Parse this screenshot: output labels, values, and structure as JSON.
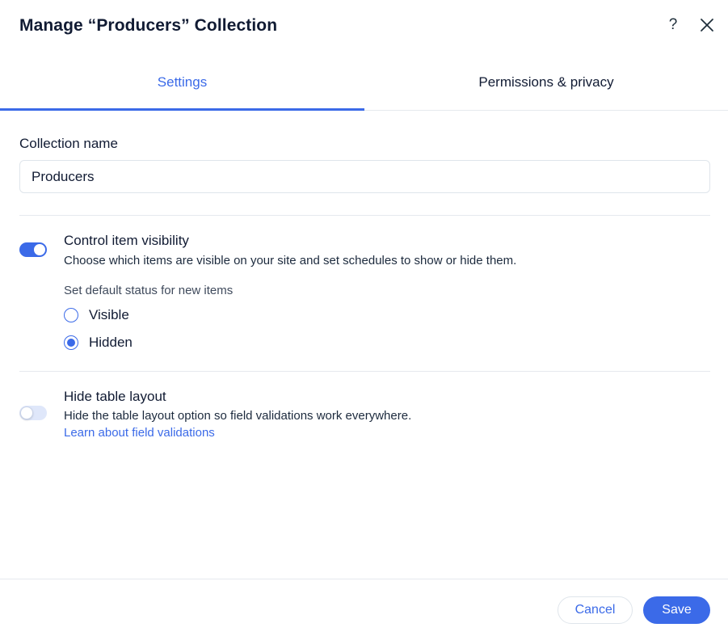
{
  "dialog": {
    "title": "Manage “Producers” Collection",
    "help_label": "?"
  },
  "tabs": [
    {
      "label": "Settings",
      "active": true
    },
    {
      "label": "Permissions & privacy",
      "active": false
    }
  ],
  "collection_name": {
    "label": "Collection name",
    "value": "Producers"
  },
  "visibility": {
    "enabled": true,
    "title": "Control item visibility",
    "description": "Choose which items are visible on your site and set schedules to show or hide them.",
    "default_status_label": "Set default status for new items",
    "options": [
      {
        "label": "Visible",
        "selected": false
      },
      {
        "label": "Hidden",
        "selected": true
      }
    ]
  },
  "table_layout": {
    "enabled": false,
    "title": "Hide table layout",
    "description": "Hide the table layout option so field validations work everywhere.",
    "link": "Learn about field validations"
  },
  "footer": {
    "cancel_label": "Cancel",
    "save_label": "Save"
  },
  "colors": {
    "accent": "#3b6ae8",
    "text": "#111b33",
    "divider": "#e6e9ee"
  }
}
